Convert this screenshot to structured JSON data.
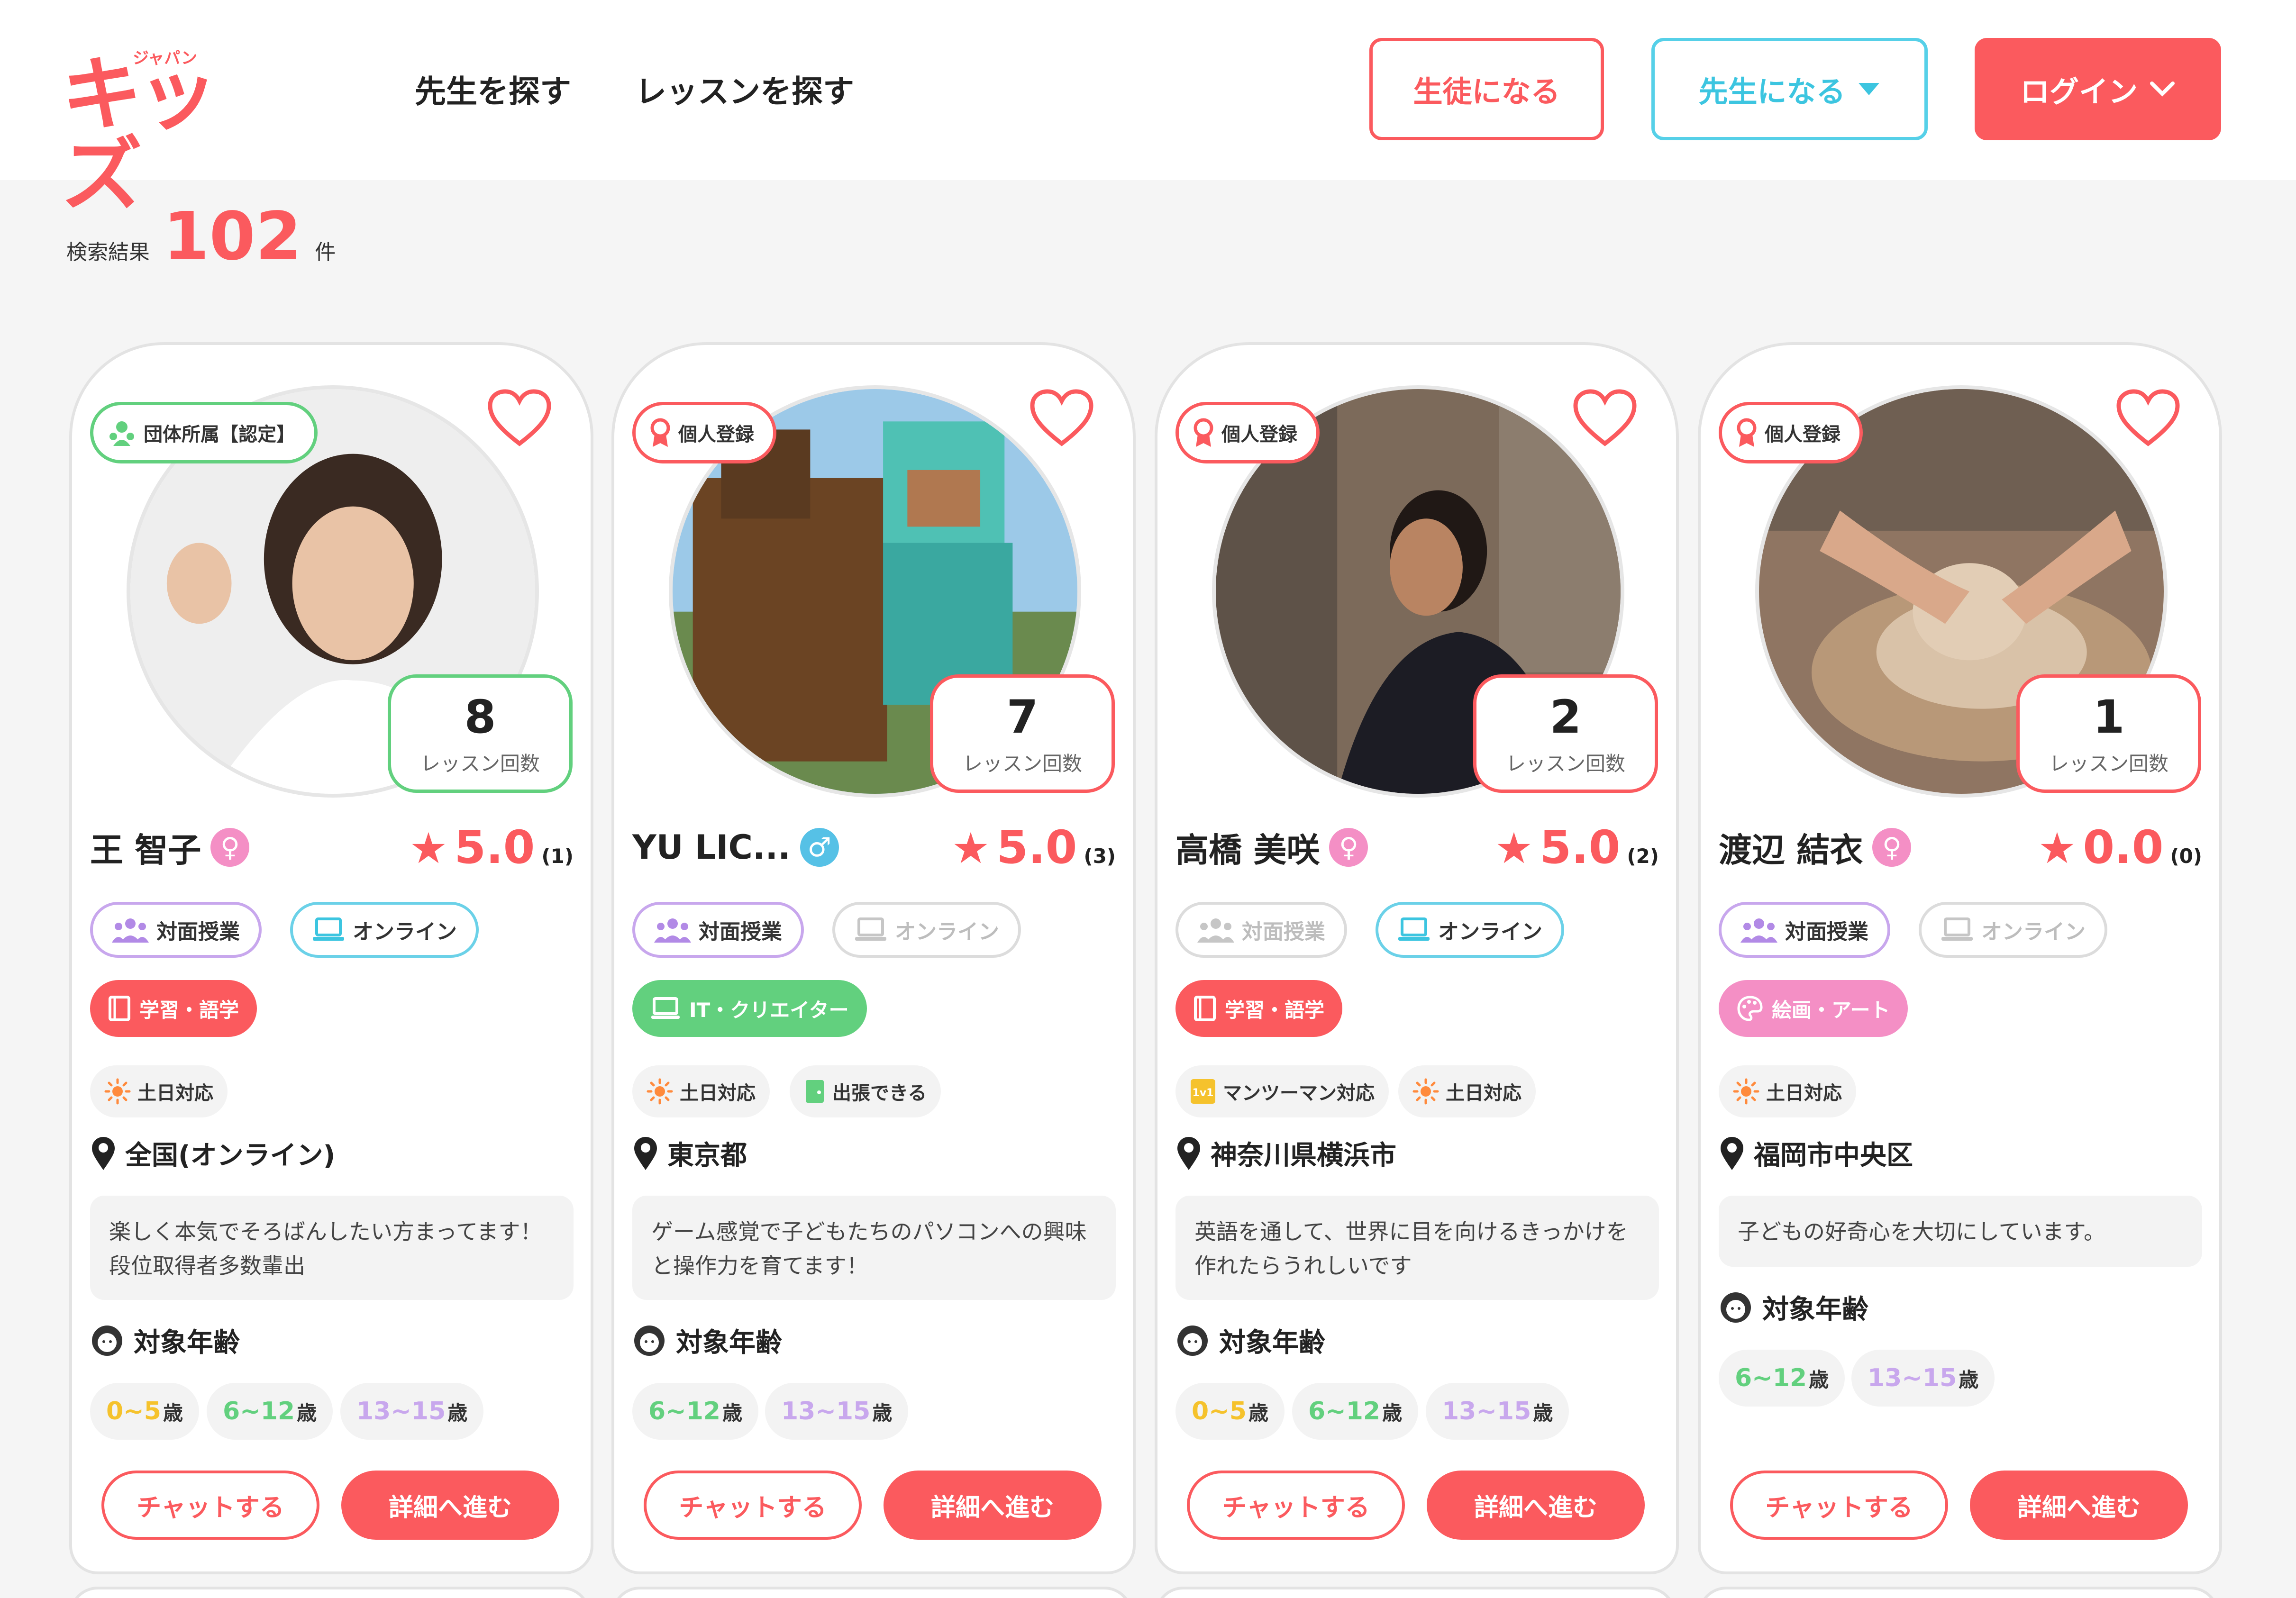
{
  "header": {
    "logo_text": "キッズ",
    "logo_sub": "ジャパン",
    "nav": [
      "先生を探す",
      "レッスンを探す"
    ],
    "student_btn": "生徒になる",
    "teacher_btn": "先生になる",
    "login_btn": "ログイン"
  },
  "results": {
    "label": "検索結果",
    "count": "102",
    "unit": "件"
  },
  "labels": {
    "lesson_count": "レッスン回数",
    "target_age": "対象年齢",
    "chat": "チャットする",
    "detail": "詳細へ進む",
    "face_to_face": "対面授業",
    "online": "オンライン"
  },
  "cards": [
    {
      "badge": "団体所属【認定】",
      "badge_color": "#62d07e",
      "lessons": "8",
      "name": "王 智子",
      "gender": "♀",
      "rating": "5.0",
      "reviews": "(1)",
      "face_to_face": true,
      "online": true,
      "category": "学習・語学",
      "category_color": "#fb5a5e",
      "tags": [
        "土日対応"
      ],
      "location": "全国(オンライン)",
      "description": "楽しく本気でそろばんしたい方まってます！段位取得者多数輩出",
      "ages": [
        "0~5",
        "6~12",
        "13~15"
      ]
    },
    {
      "badge": "個人登録",
      "badge_color": "#fb5a5e",
      "lessons": "7",
      "name": "YU LIC...",
      "gender": "♂",
      "rating": "5.0",
      "reviews": "(3)",
      "face_to_face": true,
      "online": false,
      "category": "IT・クリエイター",
      "category_color": "#62d07e",
      "tags": [
        "土日対応",
        "出張できる"
      ],
      "location": "東京都",
      "description": "ゲーム感覚で子どもたちのパソコンへの興味と操作力を育てます！",
      "ages": [
        "6~12",
        "13~15"
      ]
    },
    {
      "badge": "個人登録",
      "badge_color": "#fb5a5e",
      "lessons": "2",
      "name": "高橋 美咲",
      "gender": "♀",
      "rating": "5.0",
      "reviews": "(2)",
      "face_to_face": false,
      "online": true,
      "category": "学習・語学",
      "category_color": "#fb5a5e",
      "tags": [
        "マンツーマン対応",
        "土日対応"
      ],
      "location": "神奈川県横浜市",
      "description": "英語を通して、世界に目を向けるきっかけを作れたらうれしいです",
      "ages": [
        "0~5",
        "6~12",
        "13~15"
      ]
    },
    {
      "badge": "個人登録",
      "badge_color": "#fb5a5e",
      "lessons": "1",
      "name": "渡辺 結衣",
      "gender": "♀",
      "rating": "0.0",
      "reviews": "(0)",
      "face_to_face": true,
      "online": false,
      "category": "絵画・アート",
      "category_color": "#f48fc5",
      "tags": [
        "土日対応"
      ],
      "location": "福岡市中央区",
      "description": "子どもの好奇心を大切にしています。",
      "ages": [
        "6~12",
        "13~15"
      ]
    }
  ],
  "age_unit": "歳"
}
